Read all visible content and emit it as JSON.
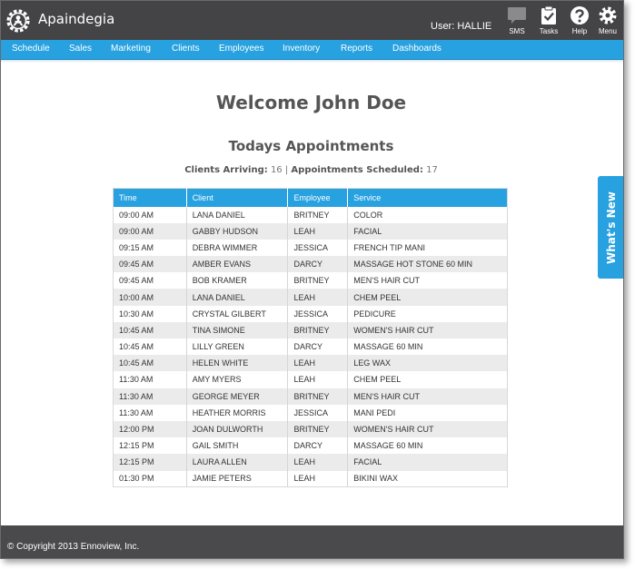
{
  "header": {
    "app_title": "Apaindegia",
    "user_label": "User: HALLIE",
    "buttons": [
      {
        "label": "SMS",
        "icon": "chat-bubble-icon"
      },
      {
        "label": "Tasks",
        "icon": "clipboard-check-icon"
      },
      {
        "label": "Help",
        "icon": "question-circle-icon"
      },
      {
        "label": "Menu",
        "icon": "gear-icon"
      }
    ]
  },
  "nav": {
    "items": [
      "Schedule",
      "Sales",
      "Marketing",
      "Clients",
      "Employees",
      "Inventory",
      "Reports",
      "Dashboards"
    ]
  },
  "main": {
    "welcome": "Welcome John Doe",
    "subheading": "Todays Appointments",
    "summary": {
      "arriving_label": "Clients Arriving:",
      "arriving_value": "16",
      "separator": "|",
      "scheduled_label": "Appointments Scheduled:",
      "scheduled_value": "17"
    }
  },
  "table": {
    "columns": [
      "Time",
      "Client",
      "Employee",
      "Service"
    ],
    "rows": [
      [
        "09:00 AM",
        "LANA DANIEL",
        "BRITNEY",
        "COLOR"
      ],
      [
        "09:00 AM",
        "GABBY HUDSON",
        "LEAH",
        "FACIAL"
      ],
      [
        "09:15 AM",
        "DEBRA WIMMER",
        "JESSICA",
        "FRENCH TIP MANI"
      ],
      [
        "09:45 AM",
        "AMBER EVANS",
        "DARCY",
        "MASSAGE HOT STONE 60 MIN"
      ],
      [
        "09:45 AM",
        "BOB KRAMER",
        "BRITNEY",
        "MEN'S HAIR CUT"
      ],
      [
        "10:00 AM",
        "LANA DANIEL",
        "LEAH",
        "CHEM PEEL"
      ],
      [
        "10:30 AM",
        "CRYSTAL GILBERT",
        "JESSICA",
        "PEDICURE"
      ],
      [
        "10:45 AM",
        "TINA SIMONE",
        "BRITNEY",
        "WOMEN'S HAIR CUT"
      ],
      [
        "10:45 AM",
        "LILLY GREEN",
        "DARCY",
        "MASSAGE 60 MIN"
      ],
      [
        "10:45 AM",
        "HELEN WHITE",
        "LEAH",
        "LEG WAX"
      ],
      [
        "11:30 AM",
        "AMY MYERS",
        "LEAH",
        "CHEM PEEL"
      ],
      [
        "11:30 AM",
        "GEORGE MEYER",
        "BRITNEY",
        "MEN'S HAIR CUT"
      ],
      [
        "11:30 AM",
        "HEATHER MORRIS",
        "JESSICA",
        "MANI PEDI"
      ],
      [
        "12:00 PM",
        "JOAN DULWORTH",
        "BRITNEY",
        "WOMEN'S HAIR CUT"
      ],
      [
        "12:15 PM",
        "GAIL SMITH",
        "DARCY",
        "MASSAGE 60 MIN"
      ],
      [
        "12:15 PM",
        "LAURA ALLEN",
        "LEAH",
        "FACIAL"
      ],
      [
        "01:30 PM",
        "JAMIE PETERS",
        "LEAH",
        "BIKINI WAX"
      ]
    ]
  },
  "side_tab": {
    "label": "What's New"
  },
  "footer": {
    "copyright": "© Copyright 2013 Ennoview, Inc."
  },
  "colors": {
    "header_bg": "#444446",
    "accent_blue": "#27a1e0",
    "footer_bg": "#4a4a4c",
    "text_dark": "#555555",
    "row_alt": "#ebebeb"
  }
}
